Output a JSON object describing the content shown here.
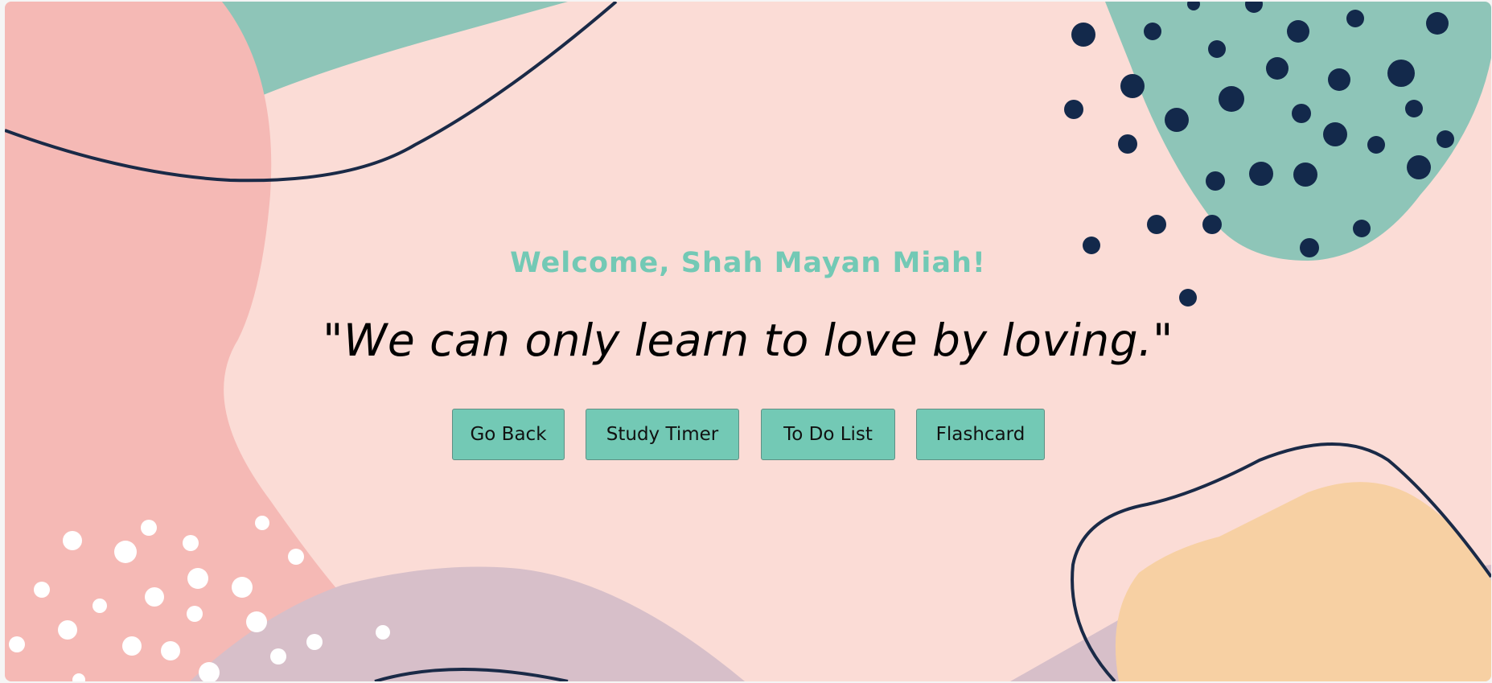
{
  "greeting": "Welcome, Shah Mayan Miah!",
  "quote": "\"We can only learn to love by loving.\"",
  "buttons": {
    "go_back": "Go Back",
    "study_timer": "Study Timer",
    "todo_list": "To Do List",
    "flashcard": "Flashcard"
  },
  "colors": {
    "background": "#fbdcd6",
    "accent": "#73c9b5",
    "navy": "#13294b"
  }
}
